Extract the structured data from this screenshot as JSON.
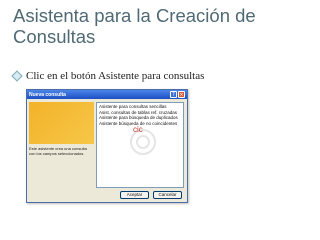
{
  "slide": {
    "title": "Asistenta para la Creación de Consultas",
    "bullet": "Clic en el botón Asistente para consultas"
  },
  "dialog": {
    "title": "Nueva consulta",
    "description": "Este asistente crea una consulta con los campos seleccionados.",
    "list_items": [
      "Asistente para consultas sencillas",
      "Asist. consultas de tablas ref. cruzadas",
      "Asistente para búsqueda de duplicados",
      "Asistente búsqueda de no coincidentes"
    ],
    "ok_label": "Aceptar",
    "cancel_label": "Cancelar",
    "watermark_text": "cic"
  },
  "colors": {
    "title": "#4f6a74",
    "titlebar": "#1c4fc4",
    "preview": "#f3b228",
    "dialog_bg": "#ece9d8"
  }
}
